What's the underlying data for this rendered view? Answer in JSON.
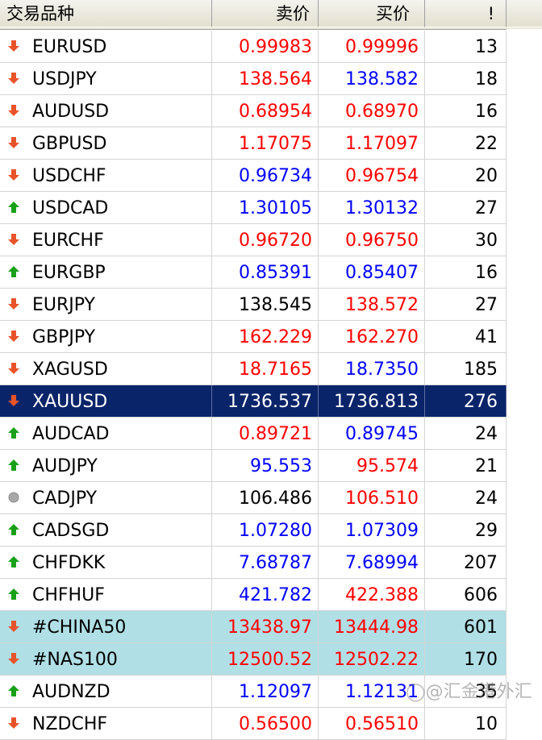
{
  "header": {
    "symbol_label": "交易品种",
    "bid_label": "卖价",
    "ask_label": "买价",
    "spread_label": "!"
  },
  "watermark": "◯@汇金港外汇",
  "colors": {
    "up": "#19a019",
    "down": "#e8532a",
    "neutral": "#a8a8a8",
    "price_up_text": "#0000ff",
    "price_down_text": "#ff0000",
    "selected_row": "#0a246a",
    "highlight_row": "#b0e0e6"
  },
  "rows": [
    {
      "symbol": "EURUSD",
      "dir": "down",
      "bid": "0.99983",
      "bid_color": "red",
      "ask": "0.99996",
      "ask_color": "red",
      "spread": "13",
      "state": ""
    },
    {
      "symbol": "USDJPY",
      "dir": "down",
      "bid": "138.564",
      "bid_color": "red",
      "ask": "138.582",
      "ask_color": "blue",
      "spread": "18",
      "state": ""
    },
    {
      "symbol": "AUDUSD",
      "dir": "down",
      "bid": "0.68954",
      "bid_color": "red",
      "ask": "0.68970",
      "ask_color": "red",
      "spread": "16",
      "state": ""
    },
    {
      "symbol": "GBPUSD",
      "dir": "down",
      "bid": "1.17075",
      "bid_color": "red",
      "ask": "1.17097",
      "ask_color": "red",
      "spread": "22",
      "state": ""
    },
    {
      "symbol": "USDCHF",
      "dir": "down",
      "bid": "0.96734",
      "bid_color": "blue",
      "ask": "0.96754",
      "ask_color": "red",
      "spread": "20",
      "state": ""
    },
    {
      "symbol": "USDCAD",
      "dir": "up",
      "bid": "1.30105",
      "bid_color": "blue",
      "ask": "1.30132",
      "ask_color": "blue",
      "spread": "27",
      "state": ""
    },
    {
      "symbol": "EURCHF",
      "dir": "down",
      "bid": "0.96720",
      "bid_color": "red",
      "ask": "0.96750",
      "ask_color": "red",
      "spread": "30",
      "state": ""
    },
    {
      "symbol": "EURGBP",
      "dir": "up",
      "bid": "0.85391",
      "bid_color": "blue",
      "ask": "0.85407",
      "ask_color": "blue",
      "spread": "16",
      "state": ""
    },
    {
      "symbol": "EURJPY",
      "dir": "down",
      "bid": "138.545",
      "bid_color": "black",
      "ask": "138.572",
      "ask_color": "red",
      "spread": "27",
      "state": ""
    },
    {
      "symbol": "GBPJPY",
      "dir": "down",
      "bid": "162.229",
      "bid_color": "red",
      "ask": "162.270",
      "ask_color": "red",
      "spread": "41",
      "state": ""
    },
    {
      "symbol": "XAGUSD",
      "dir": "down",
      "bid": "18.7165",
      "bid_color": "red",
      "ask": "18.7350",
      "ask_color": "blue",
      "spread": "185",
      "state": ""
    },
    {
      "symbol": "XAUUSD",
      "dir": "down",
      "bid": "1736.537",
      "bid_color": "black",
      "ask": "1736.813",
      "ask_color": "black",
      "spread": "276",
      "state": "sel"
    },
    {
      "symbol": "AUDCAD",
      "dir": "up",
      "bid": "0.89721",
      "bid_color": "red",
      "ask": "0.89745",
      "ask_color": "blue",
      "spread": "24",
      "state": ""
    },
    {
      "symbol": "AUDJPY",
      "dir": "up",
      "bid": "95.553",
      "bid_color": "blue",
      "ask": "95.574",
      "ask_color": "red",
      "spread": "21",
      "state": ""
    },
    {
      "symbol": "CADJPY",
      "dir": "neutral",
      "bid": "106.486",
      "bid_color": "black",
      "ask": "106.510",
      "ask_color": "red",
      "spread": "24",
      "state": ""
    },
    {
      "symbol": "CADSGD",
      "dir": "up",
      "bid": "1.07280",
      "bid_color": "blue",
      "ask": "1.07309",
      "ask_color": "blue",
      "spread": "29",
      "state": ""
    },
    {
      "symbol": "CHFDKK",
      "dir": "up",
      "bid": "7.68787",
      "bid_color": "blue",
      "ask": "7.68994",
      "ask_color": "blue",
      "spread": "207",
      "state": ""
    },
    {
      "symbol": "CHFHUF",
      "dir": "up",
      "bid": "421.782",
      "bid_color": "blue",
      "ask": "422.388",
      "ask_color": "red",
      "spread": "606",
      "state": ""
    },
    {
      "symbol": "#CHINA50",
      "dir": "down",
      "bid": "13438.97",
      "bid_color": "red",
      "ask": "13444.98",
      "ask_color": "red",
      "spread": "601",
      "state": "hl"
    },
    {
      "symbol": "#NAS100",
      "dir": "down",
      "bid": "12500.52",
      "bid_color": "red",
      "ask": "12502.22",
      "ask_color": "red",
      "spread": "170",
      "state": "hl"
    },
    {
      "symbol": "AUDNZD",
      "dir": "up",
      "bid": "1.12097",
      "bid_color": "blue",
      "ask": "1.12131",
      "ask_color": "blue",
      "spread": "35",
      "state": ""
    },
    {
      "symbol": "NZDCHF",
      "dir": "down",
      "bid": "0.56500",
      "bid_color": "red",
      "ask": "0.56510",
      "ask_color": "red",
      "spread": "10",
      "state": ""
    }
  ]
}
